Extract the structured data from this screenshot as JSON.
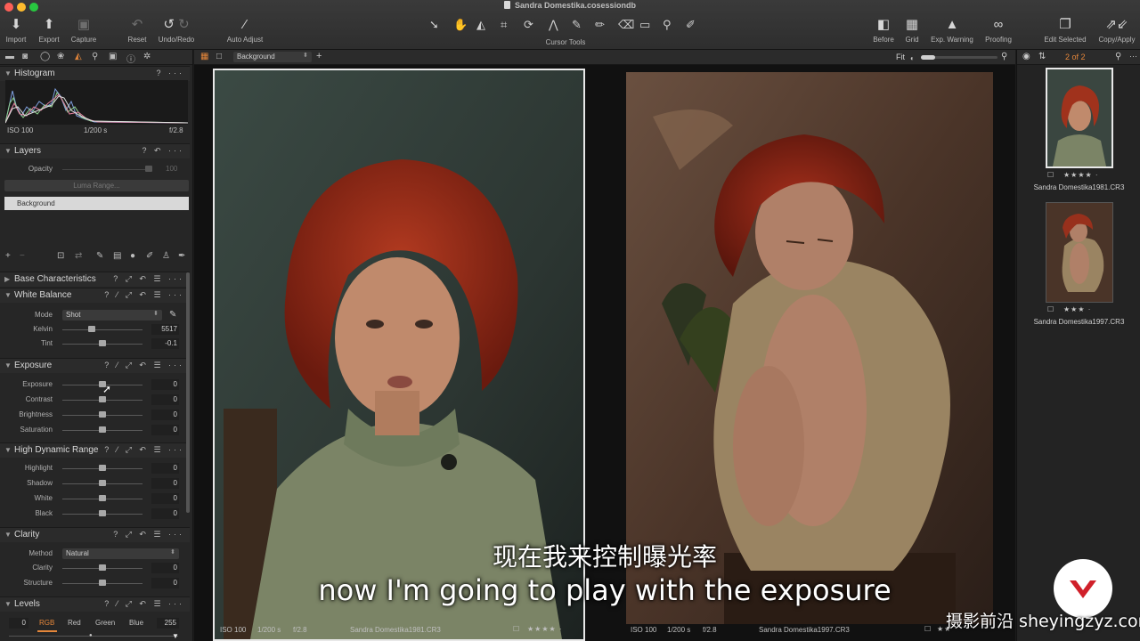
{
  "window": {
    "title": "Sandra Domestika.cosessiondb"
  },
  "toolbar": {
    "import": "Import",
    "export": "Export",
    "capture": "Capture",
    "reset": "Reset",
    "undo_redo": "Undo/Redo",
    "auto_adjust": "Auto Adjust",
    "cursor_tools": "Cursor Tools",
    "before": "Before",
    "grid": "Grid",
    "exp_warning": "Exp. Warning",
    "proofing": "Proofing",
    "edit_selected": "Edit Selected",
    "copy_apply": "Copy/Apply"
  },
  "histogram": {
    "title": "Histogram",
    "iso": "ISO 100",
    "shutter": "1/200 s",
    "aperture": "f/2.8"
  },
  "layers": {
    "title": "Layers",
    "opacity_label": "Opacity",
    "opacity_value": "100",
    "luma_range": "Luma Range...",
    "layer_name": "Background"
  },
  "base_characteristics": {
    "title": "Base Characteristics"
  },
  "white_balance": {
    "title": "White Balance",
    "mode_label": "Mode",
    "mode_value": "Shot",
    "kelvin_label": "Kelvin",
    "kelvin_value": "5517",
    "tint_label": "Tint",
    "tint_value": "-0.1"
  },
  "exposure": {
    "title": "Exposure",
    "rows": [
      {
        "label": "Exposure",
        "value": "0"
      },
      {
        "label": "Contrast",
        "value": "0"
      },
      {
        "label": "Brightness",
        "value": "0"
      },
      {
        "label": "Saturation",
        "value": "0"
      }
    ]
  },
  "hdr": {
    "title": "High Dynamic Range",
    "rows": [
      {
        "label": "Highlight",
        "value": "0"
      },
      {
        "label": "Shadow",
        "value": "0"
      },
      {
        "label": "White",
        "value": "0"
      },
      {
        "label": "Black",
        "value": "0"
      }
    ]
  },
  "clarity": {
    "title": "Clarity",
    "method_label": "Method",
    "method_value": "Natural",
    "rows": [
      {
        "label": "Clarity",
        "value": "0"
      },
      {
        "label": "Structure",
        "value": "0"
      }
    ]
  },
  "levels": {
    "title": "Levels",
    "low": "0",
    "high": "255",
    "channels": [
      "RGB",
      "Red",
      "Green",
      "Blue"
    ]
  },
  "viewer": {
    "layer_select": "Background",
    "fit": "Fit",
    "left_photo": {
      "iso": "ISO 100",
      "shutter": "1/200 s",
      "aperture": "f/2.8",
      "name": "Sandra Domestika1981.CR3"
    },
    "right_photo": {
      "iso": "ISO 100",
      "shutter": "1/200 s",
      "aperture": "f/2.8",
      "name": "Sandra Domestika1997.CR3"
    }
  },
  "browser": {
    "count": "2 of 2",
    "items": [
      {
        "name": "Sandra Domestika1981.CR3"
      },
      {
        "name": "Sandra Domestika1997.CR3"
      }
    ]
  },
  "subtitles": {
    "cn": "现在我来控制曝光率",
    "en": "now I'm going to play with the exposure"
  },
  "watermark": {
    "text": "摄影前沿 sheyingzyz.com"
  },
  "colors": {
    "accent": "#e4863a",
    "count_color": "#e4863a"
  }
}
